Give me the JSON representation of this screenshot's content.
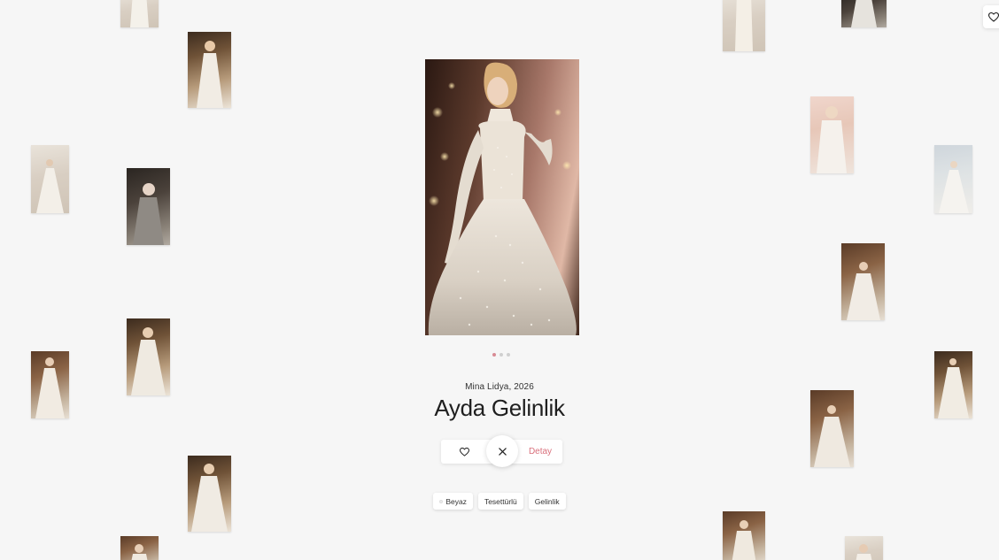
{
  "product": {
    "meta": "Mina Lidya, 2026",
    "title": "Ayda Gelinlik",
    "detail_label": "Detay"
  },
  "carousel": {
    "slide_count": 3,
    "active_index": 0
  },
  "tags": [
    {
      "label": "Beyaz",
      "swatch": "#eeeeee"
    },
    {
      "label": "Tesettürlü"
    },
    {
      "label": "Gelinlik"
    }
  ],
  "icons": {
    "favorite": "heart-icon",
    "close": "close-icon",
    "corner": "heart-icon"
  },
  "colors": {
    "background": "#f6f6f6",
    "accent": "#d9707c",
    "dot_active": "#d88b94",
    "dot_inactive": "#cfcfcf"
  }
}
